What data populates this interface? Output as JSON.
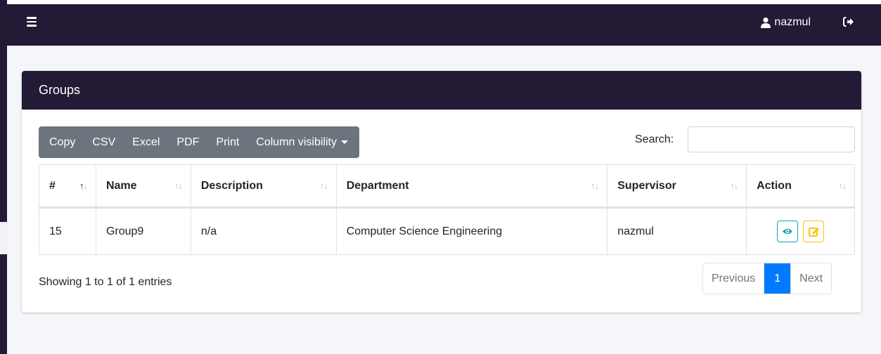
{
  "header": {
    "user_name": "nazmul"
  },
  "card": {
    "title": "Groups"
  },
  "toolbar": {
    "buttons": [
      "Copy",
      "CSV",
      "Excel",
      "PDF",
      "Print",
      "Column visibility"
    ]
  },
  "search": {
    "label": "Search:",
    "value": ""
  },
  "table": {
    "columns": [
      "#",
      "Name",
      "Description",
      "Department",
      "Supervisor",
      "Action"
    ],
    "rows": [
      {
        "id": "15",
        "name": "Group9",
        "description": "n/a",
        "department": "Computer Science Engineering",
        "supervisor": "nazmul"
      }
    ]
  },
  "footer": {
    "info": "Showing 1 to 1 of 1 entries",
    "pagination": {
      "previous": "Previous",
      "current": "1",
      "next": "Next"
    }
  },
  "icons": {
    "menu": "hamburger-icon",
    "user": "user-icon",
    "logout": "logout-icon",
    "view": "eye-icon",
    "edit": "edit-icon"
  },
  "colors": {
    "navbar": "#231a36",
    "toolbar": "#6c757d",
    "primary": "#007bff",
    "view_button": "#17a2b8",
    "edit_button": "#ffc107"
  }
}
